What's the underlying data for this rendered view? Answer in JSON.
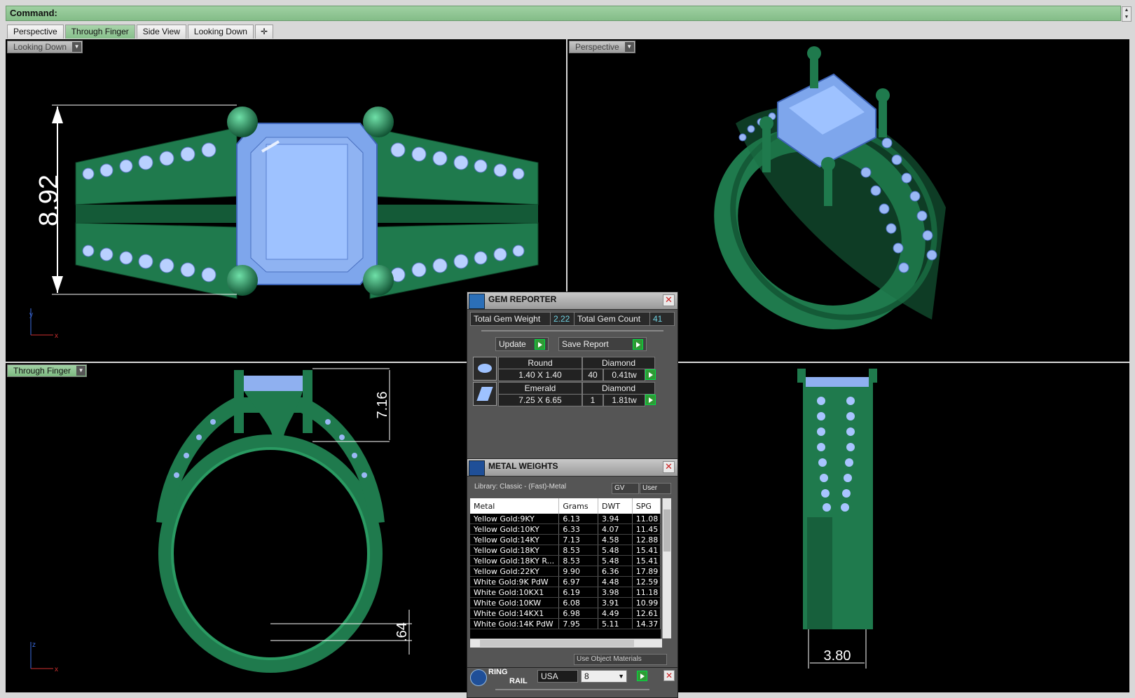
{
  "command": {
    "label": "Command:"
  },
  "tabs": [
    {
      "label": "Perspective",
      "active": false
    },
    {
      "label": "Through Finger",
      "active": true
    },
    {
      "label": "Side View",
      "active": false
    },
    {
      "label": "Looking Down",
      "active": false
    }
  ],
  "tab_add_icon": "plus-icon",
  "viewports": {
    "top_left": {
      "label": "Looking Down",
      "dimension": "8.92",
      "axes": [
        "y",
        "x"
      ]
    },
    "top_right": {
      "label": "Perspective"
    },
    "bottom_left": {
      "label": "Through Finger",
      "dim_top": "7.16",
      "dim_bottom": ".64",
      "axes": [
        "z",
        "x"
      ]
    },
    "bottom_right": {
      "dimension": "3.80"
    }
  },
  "gem_reporter": {
    "title": "GEM REPORTER",
    "total_weight_label": "Total Gem Weight",
    "total_weight": "2.22",
    "total_count_label": "Total Gem Count",
    "total_count": "41",
    "update_label": "Update",
    "save_label": "Save Report",
    "gems": [
      {
        "shape": "Round",
        "material": "Diamond",
        "size": "1.40 X 1.40",
        "count": "40",
        "weight": "0.41tw"
      },
      {
        "shape": "Emerald",
        "material": "Diamond",
        "size": "7.25 X 6.65",
        "count": "1",
        "weight": "1.81tw"
      }
    ]
  },
  "metal_weights": {
    "title": "METAL WEIGHTS",
    "library": "Library: Classic - (Fast)-Metal",
    "gv_label": "GV",
    "user_label": "User",
    "columns": [
      "Metal",
      "Grams",
      "DWT",
      "SPG"
    ],
    "rows": [
      [
        "Yellow Gold:9KY",
        "6.13",
        "3.94",
        "11.08"
      ],
      [
        "Yellow Gold:10KY",
        "6.33",
        "4.07",
        "11.45"
      ],
      [
        "Yellow Gold:14KY",
        "7.13",
        "4.58",
        "12.88"
      ],
      [
        "Yellow Gold:18KY",
        "8.53",
        "5.48",
        "15.41"
      ],
      [
        "Yellow Gold:18KY R...",
        "8.53",
        "5.48",
        "15.41"
      ],
      [
        "Yellow Gold:22KY",
        "9.90",
        "6.36",
        "17.89"
      ],
      [
        "White Gold:9K PdW",
        "6.97",
        "4.48",
        "12.59"
      ],
      [
        "White Gold:10KX1",
        "6.19",
        "3.98",
        "11.18"
      ],
      [
        "White Gold:10KW",
        "6.08",
        "3.91",
        "10.99"
      ],
      [
        "White Gold:14KX1",
        "6.98",
        "4.49",
        "12.61"
      ],
      [
        "White Gold:14K PdW",
        "7.95",
        "5.11",
        "14.37"
      ]
    ],
    "use_object_materials": "Use Object Materials"
  },
  "ring_rail": {
    "title_line1": "RING",
    "title_line2": "RAIL",
    "standard": "USA",
    "size": "8"
  },
  "colors": {
    "metal": "#1f7a4d",
    "gem": "#8ab0f0",
    "accent_green": "#86bf8a"
  }
}
